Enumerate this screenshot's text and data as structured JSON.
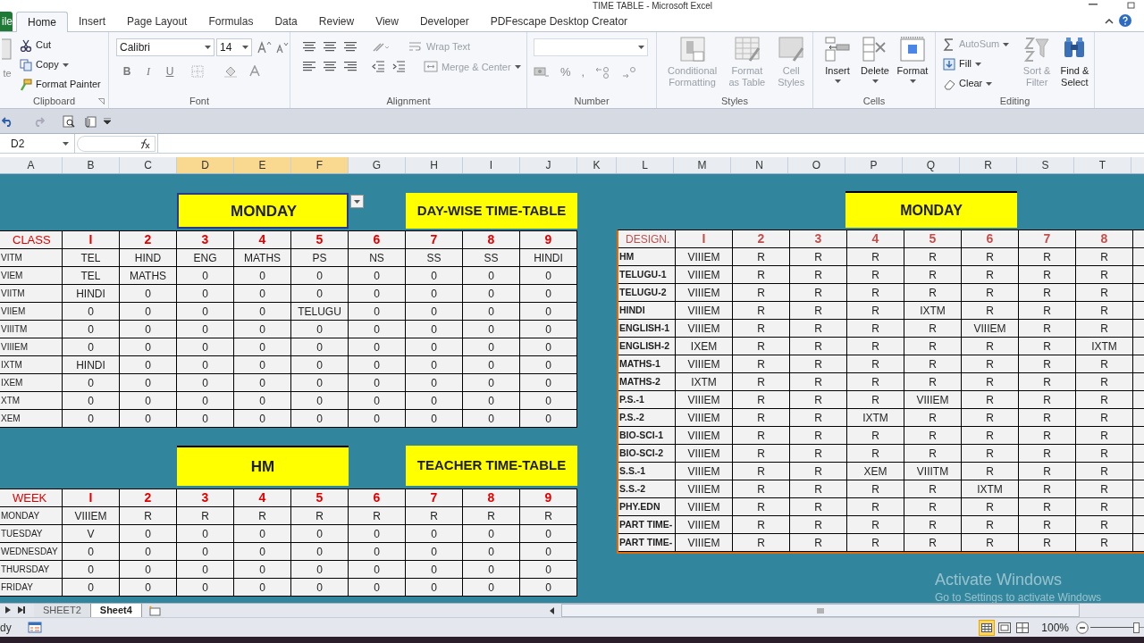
{
  "window": {
    "title": "TIME TABLE - Microsoft Excel"
  },
  "ribbon_tabs": [
    {
      "label": "ile",
      "kind": "file",
      "selected": false
    },
    {
      "label": "Home",
      "kind": "tab",
      "selected": true
    },
    {
      "label": "Insert",
      "kind": "tab",
      "selected": false
    },
    {
      "label": "Page Layout",
      "kind": "tab",
      "selected": false
    },
    {
      "label": "Formulas",
      "kind": "tab",
      "selected": false
    },
    {
      "label": "Data",
      "kind": "tab",
      "selected": false
    },
    {
      "label": "Review",
      "kind": "tab",
      "selected": false
    },
    {
      "label": "View",
      "kind": "tab",
      "selected": false
    },
    {
      "label": "Developer",
      "kind": "tab",
      "selected": false
    },
    {
      "label": "PDFescape Desktop Creator",
      "kind": "tab",
      "selected": false
    }
  ],
  "clipboard": {
    "label": "Clipboard",
    "paste": "te",
    "items": [
      {
        "kind": "cut",
        "label": "Cut"
      },
      {
        "kind": "copy",
        "label": "Copy"
      },
      {
        "kind": "painter",
        "label": "Format Painter"
      }
    ]
  },
  "font": {
    "label": "Font",
    "name": "Calibri",
    "size": "14",
    "styles": [
      "B",
      "I",
      "U"
    ]
  },
  "alignment": {
    "label": "Alignment",
    "wrap": "Wrap Text",
    "merge": "Merge & Center",
    "disabled": true
  },
  "number": {
    "label": "Number",
    "symbols": [
      "%",
      ","
    ]
  },
  "styles": {
    "label": "Styles",
    "items": [
      {
        "label": "Conditional Formatting",
        "kind": "cond",
        "disabled": true
      },
      {
        "label": "Format as Table",
        "kind": "table",
        "disabled": true
      },
      {
        "label": "Cell Styles",
        "kind": "cellstyle",
        "disabled": true
      }
    ]
  },
  "cells": {
    "label": "Cells",
    "items": [
      {
        "label": "Insert",
        "kind": "insert"
      },
      {
        "label": "Delete",
        "kind": "delete"
      },
      {
        "label": "Format",
        "kind": "format"
      }
    ]
  },
  "editing": {
    "label": "Editing",
    "small": [
      {
        "label": "AutoSum",
        "kind": "sum",
        "disabled": true
      },
      {
        "label": "Fill",
        "kind": "fill",
        "disabled": false
      },
      {
        "label": "Clear",
        "kind": "clear",
        "disabled": false
      }
    ],
    "large": [
      {
        "label": "Sort & Filter",
        "kind": "sort",
        "disabled": true
      },
      {
        "label": "Find & Select",
        "kind": "find",
        "disabled": false
      }
    ]
  },
  "formula_bar": {
    "name_box": "D2"
  },
  "columns": [
    {
      "label": "A",
      "selected": false
    },
    {
      "label": "B",
      "selected": false
    },
    {
      "label": "C",
      "selected": false
    },
    {
      "label": "D",
      "selected": true
    },
    {
      "label": "E",
      "selected": true
    },
    {
      "label": "F",
      "selected": true
    },
    {
      "label": "G",
      "selected": false
    },
    {
      "label": "H",
      "selected": false
    },
    {
      "label": "I",
      "selected": false
    },
    {
      "label": "J",
      "selected": false
    },
    {
      "label": "K",
      "selected": false
    },
    {
      "label": "L",
      "selected": false
    },
    {
      "label": "M",
      "selected": false
    },
    {
      "label": "N",
      "selected": false
    },
    {
      "label": "O",
      "selected": false
    },
    {
      "label": "P",
      "selected": false
    },
    {
      "label": "Q",
      "selected": false
    },
    {
      "label": "R",
      "selected": false
    },
    {
      "label": "S",
      "selected": false
    },
    {
      "label": "T",
      "selected": false
    }
  ],
  "day_table": {
    "title": {
      "text": "MONDAY",
      "selected": true
    },
    "subtitle": "DAY-WISE TIME-TABLE",
    "header": [
      "CLASS",
      "I",
      "2",
      "3",
      "4",
      "5",
      "6",
      "7",
      "8",
      "9"
    ],
    "rows": [
      {
        "label": "VITM",
        "cells": [
          "TEL",
          "HIND",
          "ENG",
          "MATHS",
          "PS",
          "NS",
          "SS",
          "SS",
          "HINDI"
        ]
      },
      {
        "label": "VIEM",
        "cells": [
          "TEL",
          "MATHS",
          "0",
          "0",
          "0",
          "0",
          "0",
          "0",
          "0"
        ]
      },
      {
        "label": "VIITM",
        "cells": [
          "HINDI",
          "0",
          "0",
          "0",
          "0",
          "0",
          "0",
          "0",
          "0"
        ]
      },
      {
        "label": "VIIEM",
        "cells": [
          "0",
          "0",
          "0",
          "0",
          "TELUGU",
          "0",
          "0",
          "0",
          "0"
        ]
      },
      {
        "label": "VIIITM",
        "cells": [
          "0",
          "0",
          "0",
          "0",
          "0",
          "0",
          "0",
          "0",
          "0"
        ]
      },
      {
        "label": "VIIIEM",
        "cells": [
          "0",
          "0",
          "0",
          "0",
          "0",
          "0",
          "0",
          "0",
          "0"
        ]
      },
      {
        "label": "IXTM",
        "cells": [
          "HINDI",
          "0",
          "0",
          "0",
          "0",
          "0",
          "0",
          "0",
          "0"
        ]
      },
      {
        "label": "IXEM",
        "cells": [
          "0",
          "0",
          "0",
          "0",
          "0",
          "0",
          "0",
          "0",
          "0"
        ]
      },
      {
        "label": "XTM",
        "cells": [
          "0",
          "0",
          "0",
          "0",
          "0",
          "0",
          "0",
          "0",
          "0"
        ]
      },
      {
        "label": "XEM",
        "cells": [
          "0",
          "0",
          "0",
          "0",
          "0",
          "0",
          "0",
          "0",
          "0"
        ]
      }
    ]
  },
  "teacher_table": {
    "title": {
      "text": "HM",
      "selected": false
    },
    "subtitle": "TEACHER TIME-TABLE",
    "header": [
      "WEEK",
      "I",
      "2",
      "3",
      "4",
      "5",
      "6",
      "7",
      "8",
      "9"
    ],
    "rows": [
      {
        "label": "MONDAY",
        "cells": [
          "VIIIEM",
          "R",
          "R",
          "R",
          "R",
          "R",
          "R",
          "R",
          "R"
        ]
      },
      {
        "label": "TUESDAY",
        "cells": [
          "V",
          "0",
          "0",
          "0",
          "0",
          "0",
          "0",
          "0",
          "0"
        ]
      },
      {
        "label": "WEDNESDAY",
        "cells": [
          "0",
          "0",
          "0",
          "0",
          "0",
          "0",
          "0",
          "0",
          "0"
        ]
      },
      {
        "label": "THURSDAY",
        "cells": [
          "0",
          "0",
          "0",
          "0",
          "0",
          "0",
          "0",
          "0",
          "0"
        ]
      },
      {
        "label": "FRIDAY",
        "cells": [
          "0",
          "0",
          "0",
          "0",
          "0",
          "0",
          "0",
          "0",
          "0"
        ]
      }
    ]
  },
  "staff_table": {
    "title": "MONDAY",
    "header": [
      "DESIGN.",
      "I",
      "2",
      "3",
      "4",
      "5",
      "6",
      "7",
      "8"
    ],
    "rows": [
      {
        "label": "HM",
        "cells": [
          "VIIIEM",
          "R",
          "R",
          "R",
          "R",
          "R",
          "R",
          "R"
        ]
      },
      {
        "label": "TELUGU-1",
        "cells": [
          "VIIIEM",
          "R",
          "R",
          "R",
          "R",
          "R",
          "R",
          "R"
        ]
      },
      {
        "label": "TELUGU-2",
        "cells": [
          "VIIIEM",
          "R",
          "R",
          "R",
          "R",
          "R",
          "R",
          "R"
        ]
      },
      {
        "label": "HINDI",
        "cells": [
          "VIIIEM",
          "R",
          "R",
          "R",
          "IXTM",
          "R",
          "R",
          "R"
        ]
      },
      {
        "label": "ENGLISH-1",
        "cells": [
          "VIIIEM",
          "R",
          "R",
          "R",
          "R",
          "VIIIEM",
          "R",
          "R"
        ]
      },
      {
        "label": "ENGLISH-2",
        "cells": [
          "IXEM",
          "R",
          "R",
          "R",
          "R",
          "R",
          "R",
          "IXTM"
        ]
      },
      {
        "label": "MATHS-1",
        "cells": [
          "VIIIEM",
          "R",
          "R",
          "R",
          "R",
          "R",
          "R",
          "R"
        ]
      },
      {
        "label": "MATHS-2",
        "cells": [
          "IXTM",
          "R",
          "R",
          "R",
          "R",
          "R",
          "R",
          "R"
        ]
      },
      {
        "label": "P.S.-1",
        "cells": [
          "VIIIEM",
          "R",
          "R",
          "R",
          "VIIIEM",
          "R",
          "R",
          "R"
        ]
      },
      {
        "label": "P.S.-2",
        "cells": [
          "VIIIEM",
          "R",
          "R",
          "IXTM",
          "R",
          "R",
          "R",
          "R"
        ]
      },
      {
        "label": "BIO-SCI-1",
        "cells": [
          "VIIIEM",
          "R",
          "R",
          "R",
          "R",
          "R",
          "R",
          "R"
        ]
      },
      {
        "label": "BIO-SCI-2",
        "cells": [
          "VIIIEM",
          "R",
          "R",
          "R",
          "R",
          "R",
          "R",
          "R"
        ]
      },
      {
        "label": "S.S.-1",
        "cells": [
          "VIIIEM",
          "R",
          "R",
          "XEM",
          "VIIITM",
          "R",
          "R",
          "R"
        ]
      },
      {
        "label": "S.S.-2",
        "cells": [
          "VIIIEM",
          "R",
          "R",
          "R",
          "R",
          "IXTM",
          "R",
          "R"
        ]
      },
      {
        "label": "PHY.EDN",
        "cells": [
          "VIIIEM",
          "R",
          "R",
          "R",
          "R",
          "R",
          "R",
          "R"
        ]
      },
      {
        "label": "PART TIME-",
        "cells": [
          "VIIIEM",
          "R",
          "R",
          "R",
          "R",
          "R",
          "R",
          "R"
        ]
      },
      {
        "label": "PART TIME-",
        "cells": [
          "VIIIEM",
          "R",
          "R",
          "R",
          "R",
          "R",
          "R",
          "R"
        ]
      }
    ]
  },
  "sheet_tabs": [
    {
      "label": "SHEET2",
      "selected": false
    },
    {
      "label": "Sheet4",
      "selected": true
    }
  ],
  "os_notice": {
    "title": "Activate Windows",
    "subtitle": "Go to Settings to activate Windows"
  },
  "status_bar": {
    "state": "dy",
    "zoom": "100%",
    "zoom_slider": {
      "level": 0.85
    }
  }
}
